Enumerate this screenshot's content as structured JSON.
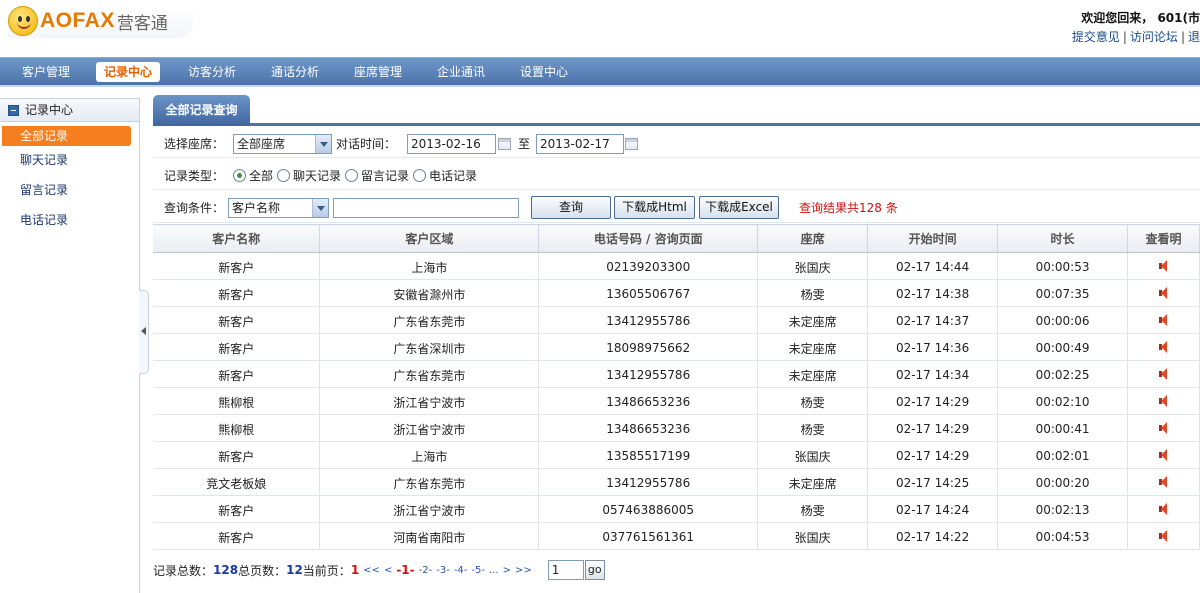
{
  "header": {
    "brand": "AOFAX",
    "brand_cn": "营客通",
    "welcome": "欢迎您回来， 601(市",
    "links": [
      "提交意见",
      "访问论坛",
      "退"
    ]
  },
  "nav": {
    "items": [
      "客户管理",
      "记录中心",
      "访客分析",
      "通话分析",
      "座席管理",
      "企业通讯",
      "设置中心"
    ],
    "active": "记录中心"
  },
  "sidebar": {
    "title": "记录中心",
    "items": [
      "全部记录",
      "聊天记录",
      "留言记录",
      "电话记录"
    ],
    "active": "全部记录"
  },
  "tab": {
    "label": "全部记录查询"
  },
  "filters": {
    "seat_label": "选择座席：",
    "seat_value": "全部座席",
    "time_label": "对话时间：",
    "date_from": "2013-02-16",
    "to_label": "至",
    "date_to": "2013-02-17",
    "type_label": "记录类型：",
    "types": [
      "全部",
      "聊天记录",
      "留言记录",
      "电话记录"
    ],
    "type_selected": "全部",
    "cond_label": "查询条件：",
    "cond_value": "客户名称",
    "keyword_value": "",
    "search_btn": "查询",
    "html_btn": "下载成Html",
    "excel_btn": "下载成Excel",
    "result_text": "查询结果共128 条"
  },
  "table": {
    "headers": [
      "客户名称",
      "客户区域",
      "电话号码 / 咨询页面",
      "座席",
      "开始时间",
      "时长",
      "查看明"
    ],
    "rows": [
      [
        "新客户",
        "上海市",
        "02139203300",
        "张国庆",
        "02-17 14:44",
        "00:00:53"
      ],
      [
        "新客户",
        "安徽省滁州市",
        "13605506767",
        "杨雯",
        "02-17 14:38",
        "00:07:35"
      ],
      [
        "新客户",
        "广东省东莞市",
        "13412955786",
        "未定座席",
        "02-17 14:37",
        "00:00:06"
      ],
      [
        "新客户",
        "广东省深圳市",
        "18098975662",
        "未定座席",
        "02-17 14:36",
        "00:00:49"
      ],
      [
        "新客户",
        "广东省东莞市",
        "13412955786",
        "未定座席",
        "02-17 14:34",
        "00:02:25"
      ],
      [
        "熊柳根",
        "浙江省宁波市",
        "13486653236",
        "杨雯",
        "02-17 14:29",
        "00:02:10"
      ],
      [
        "熊柳根",
        "浙江省宁波市",
        "13486653236",
        "杨雯",
        "02-17 14:29",
        "00:00:41"
      ],
      [
        "新客户",
        "上海市",
        "13585517199",
        "张国庆",
        "02-17 14:29",
        "00:02:01"
      ],
      [
        "竞文老板娘",
        "广东省东莞市",
        "13412955786",
        "未定座席",
        "02-17 14:25",
        "00:00:20"
      ],
      [
        "新客户",
        "浙江省宁波市",
        "057463886005",
        "杨雯",
        "02-17 14:24",
        "00:02:13"
      ],
      [
        "新客户",
        "河南省南阳市",
        "037761561361",
        "张国庆",
        "02-17 14:22",
        "00:04:53"
      ]
    ]
  },
  "pager": {
    "total_label": "记录总数：",
    "total": "128",
    "pages_label": " 总页数：",
    "pages": "12",
    "current_label": " 当前页：",
    "current": "1",
    "links": [
      "<<",
      "<",
      "-1-",
      "-2-",
      "-3-",
      "-4-",
      "-5-",
      "...",
      ">",
      ">>"
    ],
    "input_value": "1",
    "go_label": "go"
  }
}
